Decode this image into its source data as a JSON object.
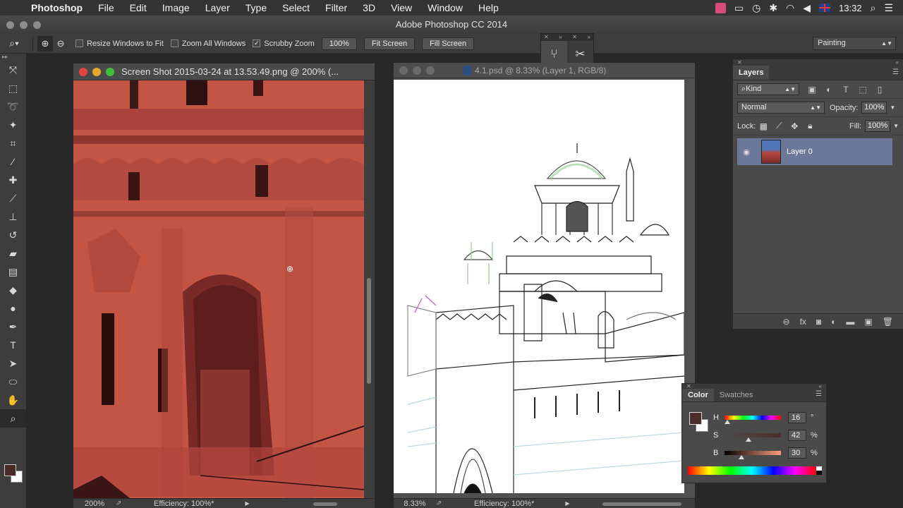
{
  "menubar": {
    "app_name": "Photoshop",
    "items": [
      "File",
      "Edit",
      "Image",
      "Layer",
      "Type",
      "Select",
      "Filter",
      "3D",
      "View",
      "Window",
      "Help"
    ],
    "clock": "13:32"
  },
  "window": {
    "title": "Adobe Photoshop CC 2014"
  },
  "options": {
    "resize_windows": "Resize Windows to Fit",
    "zoom_all": "Zoom All Windows",
    "scrubby_zoom": "Scrubby Zoom",
    "zoom_value": "100%",
    "fit_screen": "Fit Screen",
    "fill_screen": "Fill Screen",
    "workspace": "Painting"
  },
  "doc1": {
    "title": "Screen Shot 2015-03-24 at 13.53.49.png @ 200% (...",
    "zoom": "200%",
    "efficiency": "Efficiency: 100%*"
  },
  "doc2": {
    "title": "4.1.psd @ 8.33% (Layer 1, RGB/8)",
    "zoom": "8.33%",
    "efficiency": "Efficiency: 100%*"
  },
  "layers_panel": {
    "tab": "Layers",
    "kind": "Kind",
    "blend_mode": "Normal",
    "opacity_label": "Opacity:",
    "opacity": "100%",
    "lock_label": "Lock:",
    "fill_label": "Fill:",
    "fill": "100%",
    "layer_name": "Layer 0"
  },
  "color_panel": {
    "tab_color": "Color",
    "tab_swatches": "Swatches",
    "h_label": "H",
    "h_value": "16",
    "h_unit": "°",
    "s_label": "S",
    "s_value": "42",
    "s_unit": "%",
    "b_label": "B",
    "b_value": "30",
    "b_unit": "%",
    "foreground": "#4e2e2a"
  }
}
